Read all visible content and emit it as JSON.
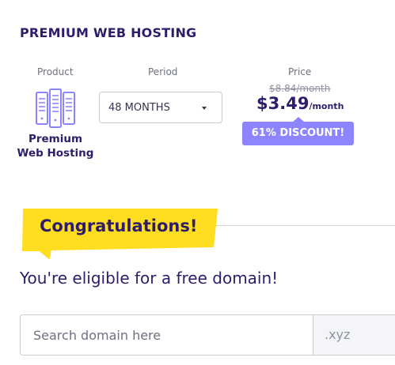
{
  "title": "PREMIUM WEB HOSTING",
  "columns": {
    "product": "Product",
    "period": "Period",
    "price": "Price"
  },
  "product": {
    "name_line1": "Premium",
    "name_line2": "Web Hosting",
    "icon": "server-icon"
  },
  "period": {
    "selected": "48 MONTHS"
  },
  "price": {
    "old": "$8.84/month",
    "amount": "$3.49",
    "per": "/month",
    "discount": "61% DISCOUNT!"
  },
  "congrats": {
    "text": "Congratulations!"
  },
  "eligible_text": "You're eligible for a free domain!",
  "domain_search": {
    "placeholder": "Search domain here",
    "value": "",
    "tld": ".xyz"
  },
  "colors": {
    "brand_text": "#2f1c6a",
    "accent": "#8c85ff",
    "highlight": "#ffde21"
  }
}
